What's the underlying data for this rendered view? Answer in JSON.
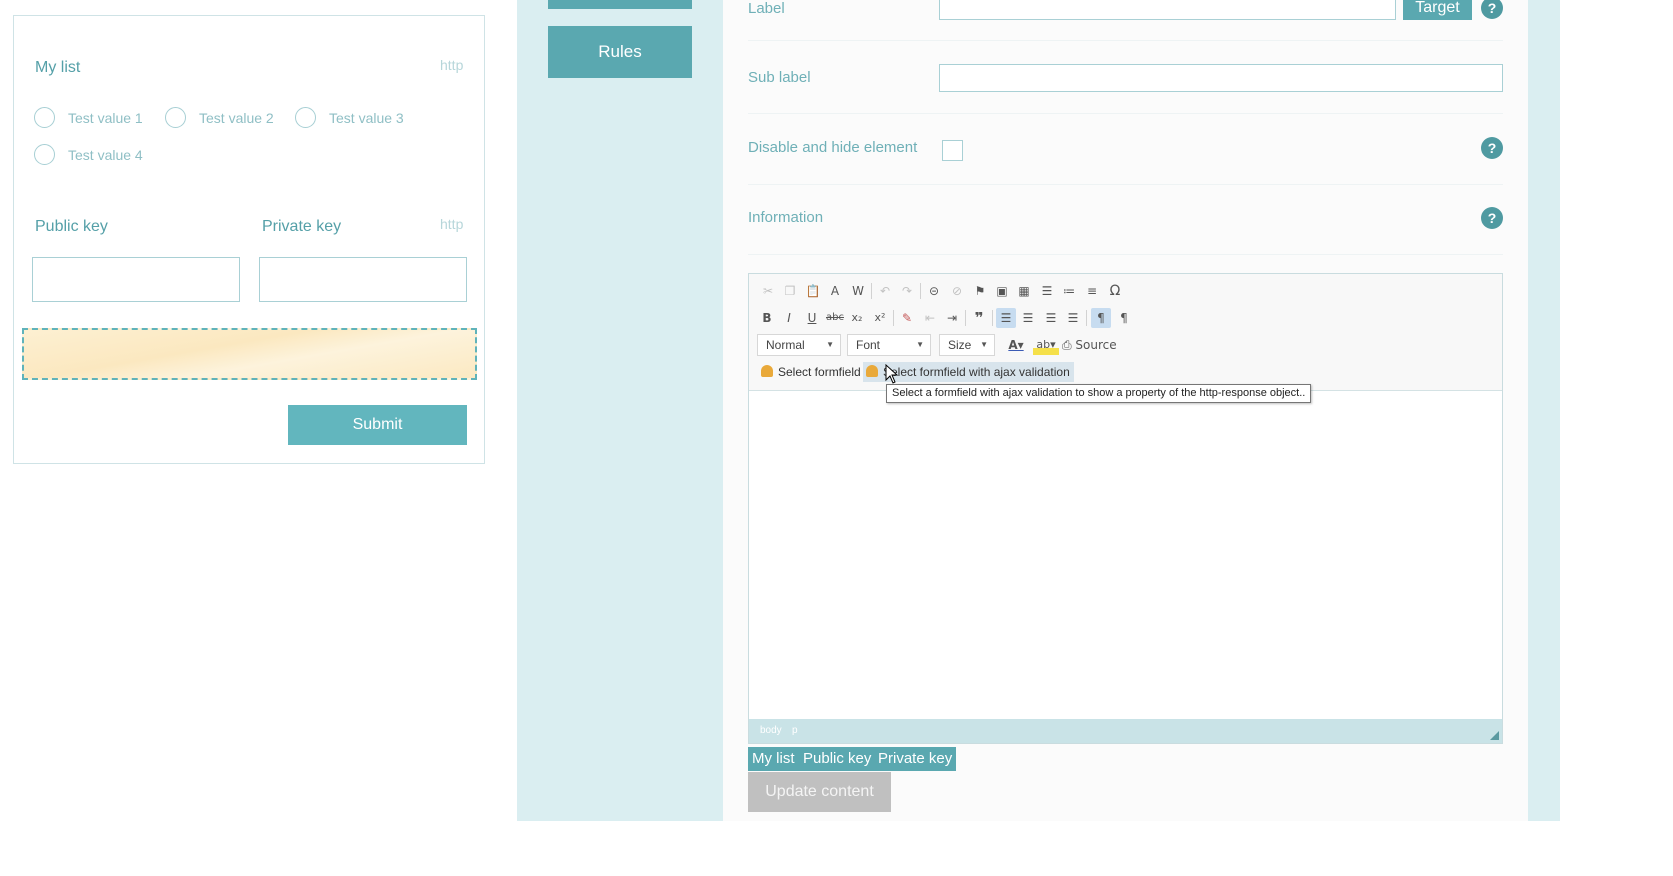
{
  "preview": {
    "list_label": "My list",
    "list_hint": "http",
    "radios": [
      "Test value 1",
      "Test value 2",
      "Test value 3",
      "Test value 4"
    ],
    "public_key_label": "Public key",
    "private_key_label": "Private key",
    "keys_hint": "http",
    "submit_label": "Submit"
  },
  "sidebar": {
    "rules_label": "Rules"
  },
  "properties": {
    "label_label": "Label",
    "label_value": "",
    "target_button": "Target",
    "sublabel_label": "Sub label",
    "sublabel_value": "",
    "disable_label": "Disable and hide element",
    "information_label": "Information",
    "help_glyph": "?"
  },
  "editor": {
    "toolbar_row1": [
      "cut-icon",
      "copy-icon",
      "paste-icon",
      "paste-text-icon",
      "paste-word-icon",
      "undo-icon",
      "redo-icon",
      "link-icon",
      "unlink-icon",
      "anchor-icon",
      "image-icon",
      "table-icon",
      "numbered-list-icon",
      "bulleted-list-icon",
      "horizontal-rule-icon",
      "special-char-icon"
    ],
    "toolbar_row2": [
      "bold-icon",
      "italic-icon",
      "underline-icon",
      "strike-icon",
      "subscript-icon",
      "superscript-icon",
      "remove-format-icon",
      "outdent-icon",
      "indent-icon",
      "blockquote-icon",
      "align-left-icon",
      "align-center-icon",
      "align-right-icon",
      "justify-icon",
      "ltr-icon",
      "rtl-icon"
    ],
    "format_combo": "Normal",
    "font_combo": "Font",
    "size_combo": "Size",
    "source_label": "Source",
    "plugin_select": "Select formfield",
    "plugin_select_ajax": "Select formfield with ajax validation",
    "tooltip": "Select a formfield with ajax validation to show a property of the http-response object..",
    "path": [
      "body",
      "p"
    ]
  },
  "tag_buttons": [
    "My list",
    "Public key",
    "Private key"
  ],
  "update_button": "Update content",
  "colors": {
    "accent": "#5aa8b0",
    "panel": "#daeef1",
    "drop_zone": "#fbe8c0"
  }
}
